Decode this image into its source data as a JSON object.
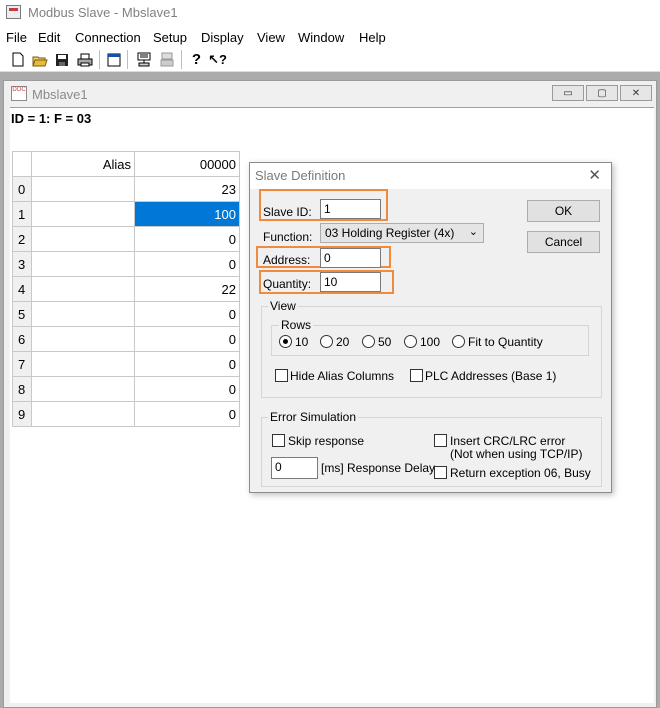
{
  "app": {
    "title": "Modbus Slave - Mbslave1",
    "menu": [
      "File",
      "Edit",
      "Connection",
      "Setup",
      "Display",
      "View",
      "Window",
      "Help"
    ]
  },
  "toolbar": {
    "icons": [
      "new-icon",
      "open-icon",
      "save-icon",
      "print-icon",
      "window-icon",
      "slave-definition-icon",
      "display-icon",
      "help-icon",
      "context-help-icon"
    ]
  },
  "child_window": {
    "title": "Mbslave1",
    "status": "ID = 1: F = 03",
    "minimize": "▭",
    "restore": "▢",
    "close": "✕"
  },
  "grid": {
    "headers": {
      "alias": "Alias",
      "value": "00000"
    },
    "rows": [
      {
        "num": "0",
        "alias": "",
        "value": "23"
      },
      {
        "num": "1",
        "alias": "",
        "value": "100"
      },
      {
        "num": "2",
        "alias": "",
        "value": "0"
      },
      {
        "num": "3",
        "alias": "",
        "value": "0"
      },
      {
        "num": "4",
        "alias": "",
        "value": "22"
      },
      {
        "num": "5",
        "alias": "",
        "value": "0"
      },
      {
        "num": "6",
        "alias": "",
        "value": "0"
      },
      {
        "num": "7",
        "alias": "",
        "value": "0"
      },
      {
        "num": "8",
        "alias": "",
        "value": "0"
      },
      {
        "num": "9",
        "alias": "",
        "value": "0"
      }
    ],
    "selected_row": 1
  },
  "dialog": {
    "title": "Slave Definition",
    "close": "✕",
    "slave_id_label": "Slave ID:",
    "slave_id_value": "1",
    "function_label": "Function:",
    "function_value": "03 Holding Register (4x)",
    "address_label": "Address:",
    "address_value": "0",
    "quantity_label": "Quantity:",
    "quantity_value": "10",
    "ok_label": "OK",
    "cancel_label": "Cancel",
    "view_group": "View",
    "rows_group": "Rows",
    "rows_options": [
      "10",
      "20",
      "50",
      "100",
      "Fit to Quantity"
    ],
    "rows_selected": "10",
    "hide_alias_label": "Hide Alias Columns",
    "plc_addresses_label": "PLC Addresses (Base 1)",
    "error_group": "Error Simulation",
    "skip_response_label": "Skip response",
    "insert_crc_label": "Insert CRC/LRC error",
    "insert_crc_note": "(Not when using TCP/IP)",
    "delay_value": "0",
    "delay_label": "[ms] Response Delay",
    "return_exception_label": "Return exception 06, Busy"
  },
  "colors": {
    "highlight": "#f08a3c",
    "selection": "#0078d7"
  }
}
